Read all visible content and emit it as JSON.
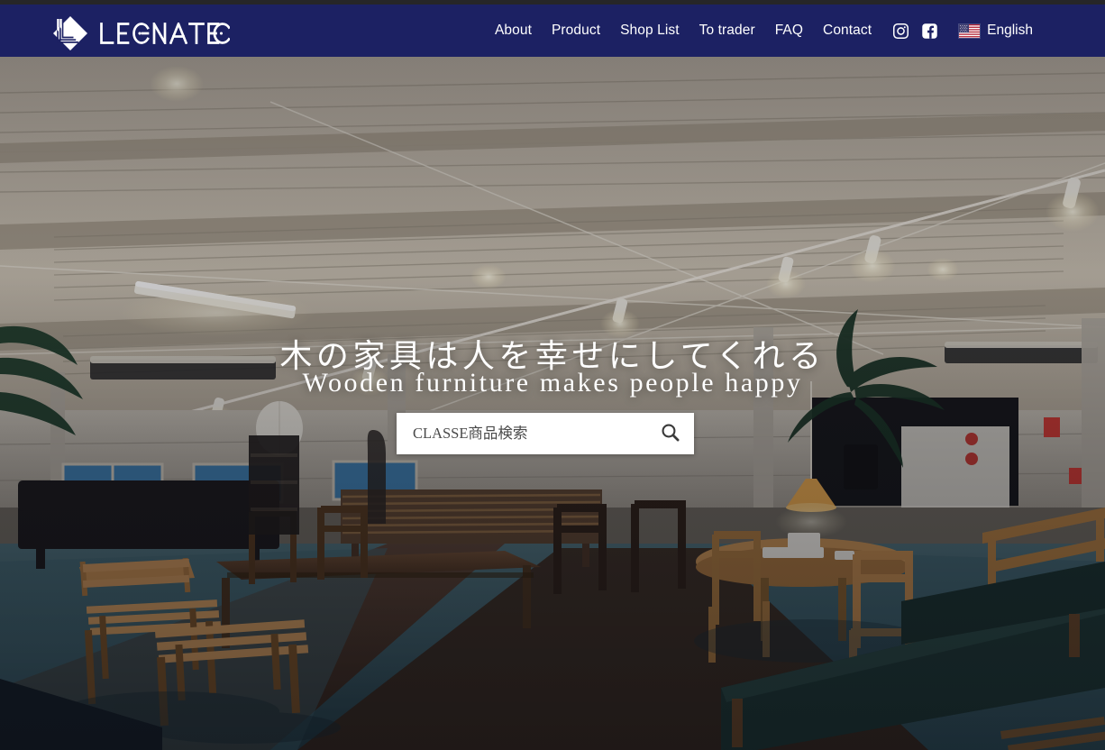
{
  "site": {
    "brand_name": "LEGNATEC",
    "header_bg": "#1c2163",
    "top_strip_bg": "#262628"
  },
  "header": {
    "logo_alt": "LEGNATEC",
    "nav": [
      {
        "label": "About",
        "name": "nav-about"
      },
      {
        "label": "Product",
        "name": "nav-product"
      },
      {
        "label": "Shop List",
        "name": "nav-shop-list"
      },
      {
        "label": "To trader",
        "name": "nav-to-trader"
      },
      {
        "label": "FAQ",
        "name": "nav-faq"
      },
      {
        "label": "Contact",
        "name": "nav-contact"
      }
    ],
    "social": [
      {
        "icon": "instagram-icon"
      },
      {
        "icon": "facebook-icon"
      }
    ],
    "language": {
      "flag": "us-flag-icon",
      "label": "English"
    }
  },
  "hero": {
    "headline_jp": "木の家具は人を幸せにしてくれる",
    "headline_en": "Wooden furniture makes people happy",
    "image_alt": "showroom-interior",
    "search": {
      "placeholder": "CLASSE商品検索",
      "value": "",
      "button_icon": "search-icon"
    }
  }
}
